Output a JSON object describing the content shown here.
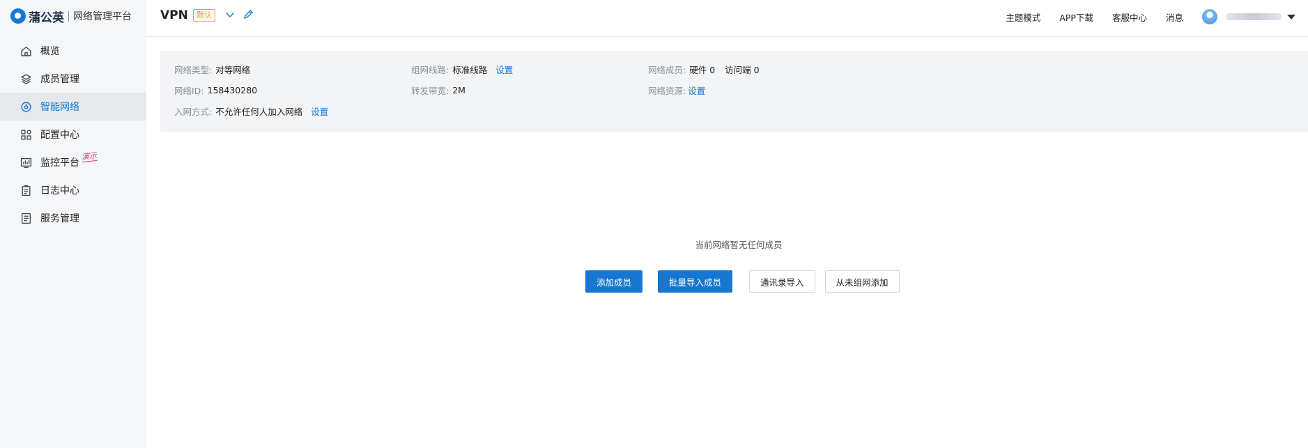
{
  "logo": {
    "brand": "蒲公英",
    "subtitle": "网络管理平台"
  },
  "sidebar": {
    "items": [
      {
        "label": "概览",
        "icon": "home-icon"
      },
      {
        "label": "成员管理",
        "icon": "layers-icon"
      },
      {
        "label": "智能网络",
        "icon": "network-icon",
        "active": true
      },
      {
        "label": "配置中心",
        "icon": "grid-icon"
      },
      {
        "label": "监控平台",
        "icon": "monitor-icon",
        "badge": "演示"
      },
      {
        "label": "日志中心",
        "icon": "clipboard-icon"
      },
      {
        "label": "服务管理",
        "icon": "document-icon"
      }
    ]
  },
  "header": {
    "title": "VPN",
    "tag": "默认",
    "links": [
      "主题模式",
      "APP下载",
      "客服中心",
      "消息"
    ]
  },
  "panel": {
    "network_type": {
      "label": "网络类型:",
      "value": "对等网络"
    },
    "route": {
      "label": "组网线路:",
      "value": "标准线路",
      "link": "设置"
    },
    "members": {
      "label": "网络成员:",
      "hardware": "硬件 0",
      "visitors": "访问端 0"
    },
    "network_id": {
      "label": "网络ID:",
      "value": "158430280"
    },
    "bandwidth": {
      "label": "转发带宽:",
      "value": "2M"
    },
    "resources": {
      "label": "网络资源:",
      "link": "设置"
    },
    "join_mode": {
      "label": "入网方式:",
      "value": "不允许任何人加入网络",
      "link": "设置"
    }
  },
  "empty_state": {
    "message": "当前网络暂无任何成员",
    "buttons": [
      "添加成员",
      "批量导入成员",
      "通讯录导入",
      "从未组网添加"
    ]
  },
  "colors": {
    "accent": "#1677d2",
    "tag": "#f29a1f",
    "demo": "#e8336b",
    "sidebar_bg": "#f5f6f8",
    "panel_bg": "#f3f4f6"
  }
}
